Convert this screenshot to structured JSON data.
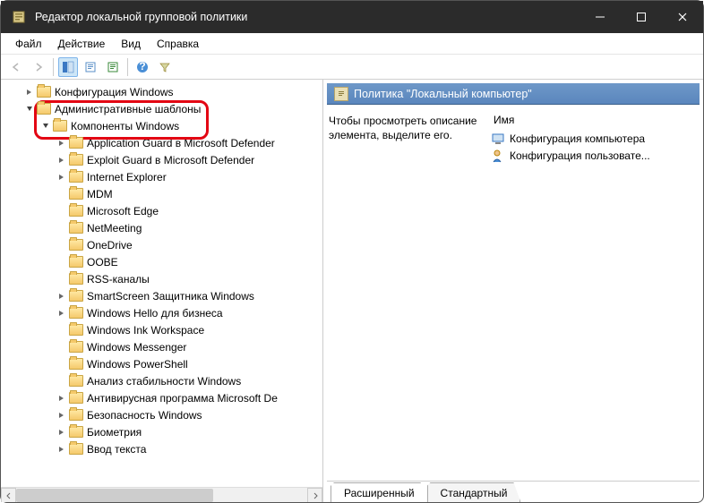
{
  "window": {
    "title": "Редактор локальной групповой политики"
  },
  "menu": {
    "file": "Файл",
    "action": "Действие",
    "view": "Вид",
    "help": "Справка"
  },
  "tree": {
    "node0": "Конфигурация Windows",
    "node1": "Административные шаблоны",
    "node2": "Компоненты Windows",
    "c0": "Application Guard в Microsoft Defender",
    "c1": "Exploit Guard в Microsoft Defender",
    "c2": "Internet Explorer",
    "c3": "MDM",
    "c4": "Microsoft Edge",
    "c5": "NetMeeting",
    "c6": "OneDrive",
    "c7": "OOBE",
    "c8": "RSS-каналы",
    "c9": "SmartScreen Защитника Windows",
    "c10": "Windows Hello для бизнеса",
    "c11": "Windows Ink Workspace",
    "c12": "Windows Messenger",
    "c13": "Windows PowerShell",
    "c14": "Анализ стабильности Windows",
    "c15": "Антивирусная программа Microsoft De",
    "c16": "Безопасность Windows",
    "c17": "Биометрия",
    "c18": "Ввод текста"
  },
  "right": {
    "header": "Политика \"Локальный компьютер\"",
    "desc": "Чтобы просмотреть описание элемента, выделите его.",
    "col_name": "Имя",
    "item0": "Конфигурация компьютера",
    "item1": "Конфигурация пользовате..."
  },
  "tabs": {
    "ext": "Расширенный",
    "std": "Стандартный"
  }
}
